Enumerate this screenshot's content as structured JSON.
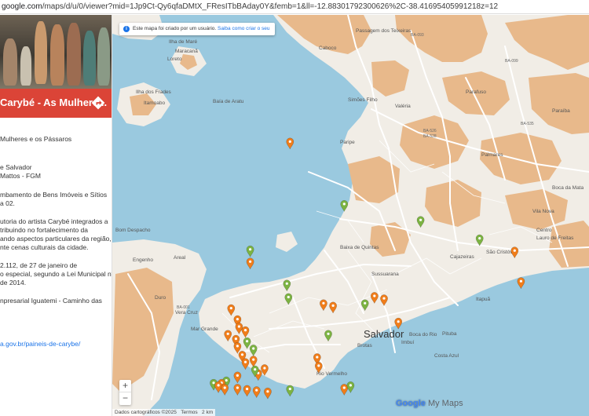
{
  "browser": {
    "url_host": "google.com",
    "url_rest": "/maps/d/u/0/viewer?mid=1Jp9Ct-Qy6qfaDMtX_FResITbBAday0Y&femb=1&ll=-12.88301792300626%2C-38.41695405991218z=12"
  },
  "sidebar": {
    "title": "Carybé - As Mulhere...",
    "lines": [
      "Mulheres e os Pássaros",
      "e Salvador",
      "Mattos - FGM",
      "mbamento de Bens Imóveis e Sítios",
      "a 02.",
      "utoria do artista Carybé integrados a",
      "tribuindo no fortalecimento da",
      "ando aspectos particulares da região,",
      "nte cenas culturais da cidade.",
      "2.112, de 27 de janeiro de",
      "o especial, segundo a Lei Municipal nº",
      "de 2014.",
      "npresarial Iguatemi - Caminho das",
      "a.gov.br/paineis-de-carybe/"
    ],
    "directions_icon": "directions-icon"
  },
  "map": {
    "notice_text": "Este mapa foi criado por um usuário.",
    "notice_link": "Saiba como criar o seu",
    "zoom_in": "+",
    "zoom_out": "−",
    "footer_attrib": "Dados cartográficos ©2025",
    "footer_terms": "Termos",
    "footer_scale": "2 km",
    "logo_google": "Google",
    "logo_mymaps": "My Maps",
    "colors": {
      "water": "#9ac9df",
      "land": "#f1ede6",
      "hills": "#e8b98b",
      "road": "#ffffff",
      "marker_orange": "#f07d1a",
      "marker_green": "#7cb342",
      "header_red": "#db4437"
    },
    "labels": [
      "Passagem dos Teixeiras",
      "Maracanã",
      "Caboco",
      "BA-093",
      "Loreto",
      "Ilha de Maré",
      "Ilha dos Frades",
      "Itamoabo",
      "Baía de Aratu",
      "Simões Filho",
      "Parafuso",
      "BA-526",
      "BA-528",
      "Paripe",
      "BA-535",
      "Lauro de Freitas",
      "Centro",
      "Cajazeiras",
      "São Cristóv",
      "Bom Despacho",
      "Areal",
      "Engenho",
      "Itapuã",
      "Sussuarana",
      "Salvador",
      "Brotas",
      "Imbuí",
      "Boca do Rio",
      "Pituba",
      "Costa Azul",
      "Rio Vermelho",
      "Vera Cruz",
      "Mar Grande",
      "Duro",
      "BA-001",
      "Baixa de Quintas",
      "Vila Nova",
      "Boca da Mata",
      "BA-099",
      "Paraíba",
      "Palmares",
      "Valéria"
    ],
    "markers": [
      {
        "color": "orange",
        "lat": -12.867,
        "lng": -38.505
      },
      {
        "color": "green",
        "lat": -12.918,
        "lng": -38.471
      },
      {
        "color": "orange",
        "lat": -12.965,
        "lng": -38.53
      },
      {
        "color": "green",
        "lat": -12.955,
        "lng": -38.53
      },
      {
        "color": "green",
        "lat": -12.983,
        "lng": -38.507
      },
      {
        "color": "green",
        "lat": -12.994,
        "lng": -38.506
      },
      {
        "color": "orange",
        "lat": -12.999,
        "lng": -38.484
      },
      {
        "color": "orange",
        "lat": -13.001,
        "lng": -38.478
      },
      {
        "color": "orange",
        "lat": -12.993,
        "lng": -38.452
      },
      {
        "color": "orange",
        "lat": -12.995,
        "lng": -38.446
      },
      {
        "color": "green",
        "lat": -12.999,
        "lng": -38.458
      },
      {
        "color": "orange",
        "lat": -13.014,
        "lng": -38.437
      },
      {
        "color": "orange",
        "lat": -13.003,
        "lng": -38.542
      },
      {
        "color": "orange",
        "lat": -13.012,
        "lng": -38.538
      },
      {
        "color": "orange",
        "lat": -13.018,
        "lng": -38.537
      },
      {
        "color": "orange",
        "lat": -13.021,
        "lng": -38.533
      },
      {
        "color": "orange",
        "lat": -13.024,
        "lng": -38.544
      },
      {
        "color": "orange",
        "lat": -13.028,
        "lng": -38.539
      },
      {
        "color": "green",
        "lat": -13.03,
        "lng": -38.532
      },
      {
        "color": "orange",
        "lat": -13.034,
        "lng": -38.538
      },
      {
        "color": "green",
        "lat": -13.036,
        "lng": -38.528
      },
      {
        "color": "orange",
        "lat": -13.041,
        "lng": -38.535
      },
      {
        "color": "orange",
        "lat": -13.045,
        "lng": -38.528
      },
      {
        "color": "orange",
        "lat": -13.047,
        "lng": -38.533
      },
      {
        "color": "orange",
        "lat": -13.052,
        "lng": -38.521
      },
      {
        "color": "orange",
        "lat": -13.056,
        "lng": -38.525
      },
      {
        "color": "orange",
        "lat": -13.058,
        "lng": -38.538
      },
      {
        "color": "green",
        "lat": -13.062,
        "lng": -38.545
      },
      {
        "color": "orange",
        "lat": -13.064,
        "lng": -38.548
      },
      {
        "color": "green",
        "lat": -13.064,
        "lng": -38.553
      },
      {
        "color": "orange",
        "lat": -13.066,
        "lng": -38.55
      },
      {
        "color": "orange",
        "lat": -13.068,
        "lng": -38.546
      },
      {
        "color": "orange",
        "lat": -13.068,
        "lng": -38.538
      },
      {
        "color": "orange",
        "lat": -13.069,
        "lng": -38.532
      },
      {
        "color": "orange",
        "lat": -13.07,
        "lng": -38.526
      },
      {
        "color": "orange",
        "lat": -13.071,
        "lng": -38.519
      },
      {
        "color": "green",
        "lat": -13.069,
        "lng": -38.505
      },
      {
        "color": "green",
        "lat": -13.053,
        "lng": -38.527
      },
      {
        "color": "orange",
        "lat": -13.043,
        "lng": -38.488
      },
      {
        "color": "orange",
        "lat": -13.05,
        "lng": -38.487
      },
      {
        "color": "green",
        "lat": -13.024,
        "lng": -38.481
      },
      {
        "color": "orange",
        "lat": -13.068,
        "lng": -38.471
      },
      {
        "color": "green",
        "lat": -13.066,
        "lng": -38.467
      },
      {
        "color": "green",
        "lat": -12.946,
        "lng": -38.386
      },
      {
        "color": "orange",
        "lat": -12.956,
        "lng": -38.364
      },
      {
        "color": "orange",
        "lat": -12.981,
        "lng": -38.36
      },
      {
        "color": "green",
        "lat": -12.931,
        "lng": -38.423
      }
    ]
  }
}
